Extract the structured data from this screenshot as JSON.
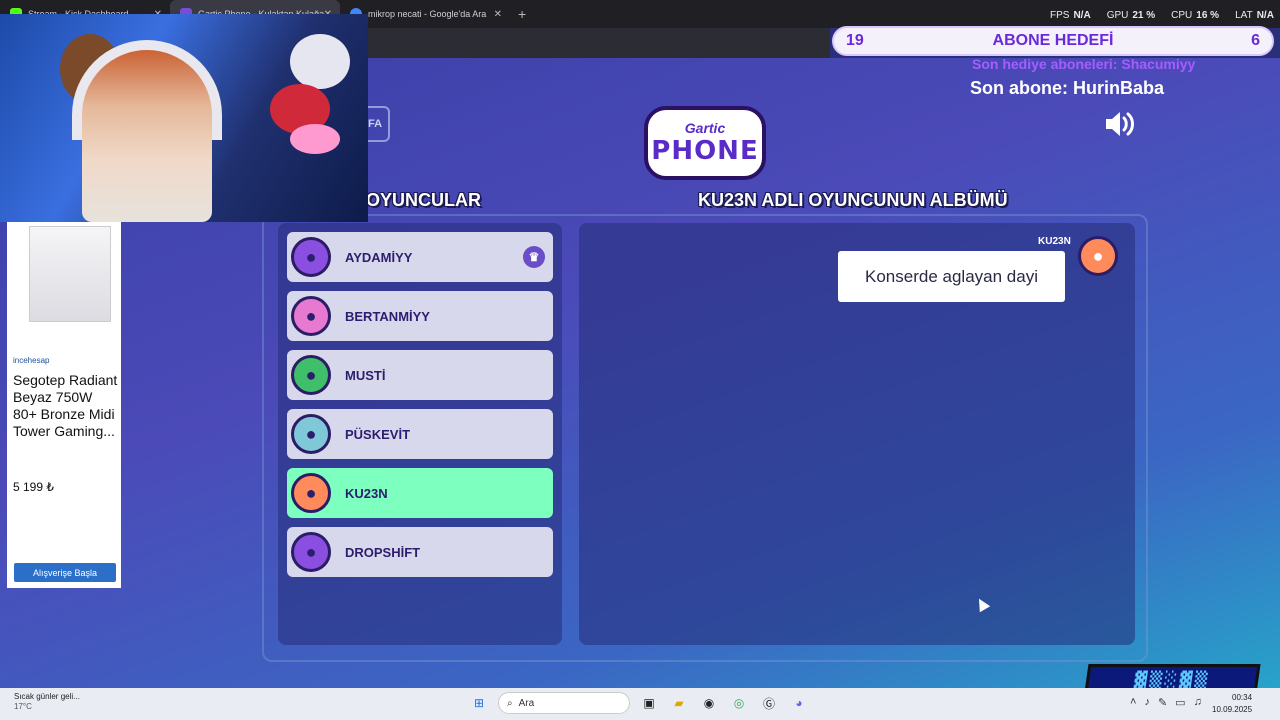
{
  "browser": {
    "tabs": [
      {
        "title": "Stream - Kick Dashboard",
        "color": "#53fc18"
      },
      {
        "title": "Gartic Phone - Kulaktan Kulağa",
        "color": "#7b4cd8"
      },
      {
        "title": "mikrop necati - Google'da Ara",
        "color": "#4285f4"
      }
    ],
    "new_tab": "+",
    "close": "✕"
  },
  "stats": [
    {
      "label": "FPS",
      "value": "N/A"
    },
    {
      "label": "GPU",
      "value": "21 %"
    },
    {
      "label": "CPU",
      "value": "16 %"
    },
    {
      "label": "LAT",
      "value": "N/A"
    }
  ],
  "subgoal": {
    "left": "19",
    "label": "ABONE HEDEFİ",
    "right": "6"
  },
  "ticker": "Son hediye aboneleri: Shacumiyy",
  "last_sub": "Son abone: HurinBaba",
  "game": {
    "logo_top": "Gartic",
    "logo_bottom": "PHONE",
    "back_label": "FA",
    "players_heading": "OYUNCULAR",
    "album_heading": "KU23N ADLI OYUNCUNUN ALBÜMÜ",
    "players": [
      {
        "name": "AYDAMİYY",
        "color": "#8a4fe0",
        "host": true
      },
      {
        "name": "BERTANMİYY",
        "color": "#e77ad0",
        "host": false
      },
      {
        "name": "MUSTİ",
        "color": "#3fbf6a",
        "host": false
      },
      {
        "name": "PÜSKEVİT",
        "color": "#7fc8d8",
        "host": false
      },
      {
        "name": "KU23N",
        "color": "#ff8a5c",
        "host": false
      },
      {
        "name": "DROPSHİFT",
        "color": "#8a4fe0",
        "host": false
      }
    ],
    "message": {
      "author": "KU23N",
      "text": "Konserde aglayan dayi"
    }
  },
  "ad": {
    "brand": "incehesap",
    "title": "Segotep Radiant Beyaz 750W 80+ Bronze Midi Tower Gaming...",
    "price": "5 199 ₺",
    "button": "Alışverişe Başla"
  },
  "taskbar": {
    "weather_title": "Sıcak günler geli...",
    "weather_temp": "17°C",
    "search": "Ara",
    "time": "00:34",
    "date": "10.09.2025"
  }
}
